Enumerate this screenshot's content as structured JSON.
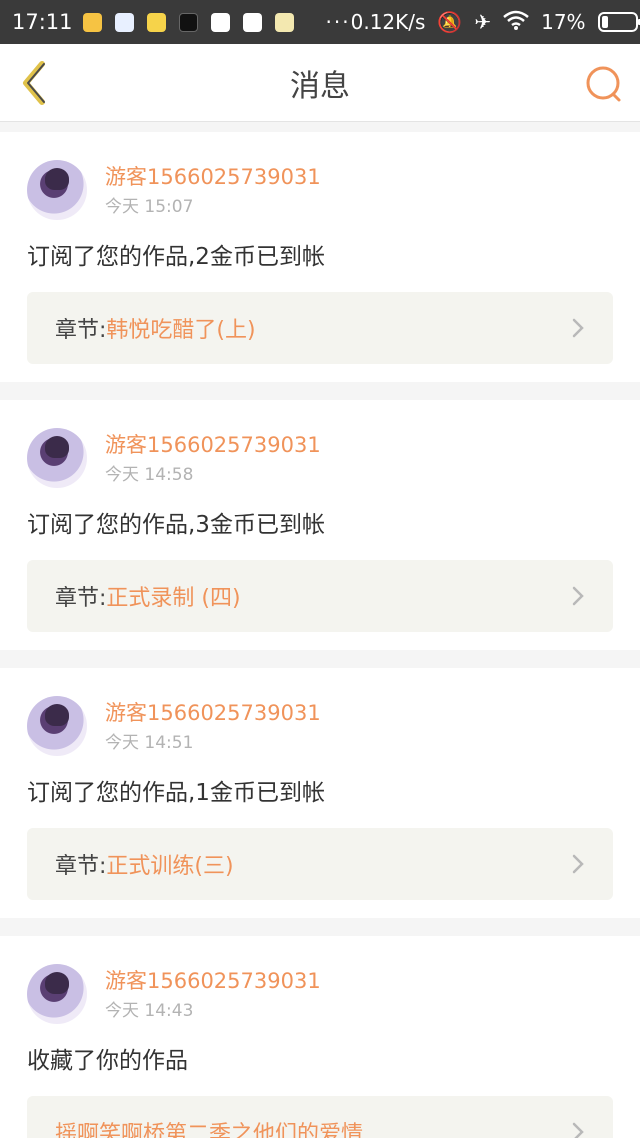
{
  "status_bar": {
    "time": "17:11",
    "dots": "···",
    "net_speed": "0.12K/s",
    "battery": "17%"
  },
  "header": {
    "title": "消息"
  },
  "colors": {
    "accent": "#f0935a",
    "chapter_bg": "#f4f4ef"
  },
  "messages": [
    {
      "username": "游客1566025739031",
      "time": "今天 15:07",
      "text": "订阅了您的作品,2金币已到帐",
      "chapter_label": "章节:",
      "chapter_title": "韩悦吃醋了(上)"
    },
    {
      "username": "游客1566025739031",
      "time": "今天 14:58",
      "text": "订阅了您的作品,3金币已到帐",
      "chapter_label": "章节:",
      "chapter_title": "正式录制 (四)"
    },
    {
      "username": "游客1566025739031",
      "time": "今天 14:51",
      "text": "订阅了您的作品,1金币已到帐",
      "chapter_label": "章节:",
      "chapter_title": "正式训练(三)"
    },
    {
      "username": "游客1566025739031",
      "time": "今天 14:43",
      "text": "收藏了你的作品",
      "chapter_label": "",
      "chapter_title": "摇啊笑啊桥第二季之他们的爱情"
    }
  ]
}
